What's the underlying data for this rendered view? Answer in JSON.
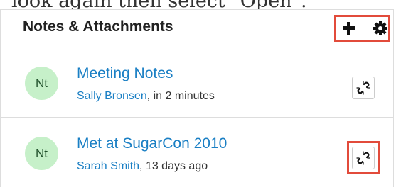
{
  "caption": {
    "text": "look again then select \"Open\"."
  },
  "dashlet": {
    "title": "Notes & Attachments",
    "actions": {
      "add_icon": "plus-icon",
      "settings_icon": "gear-icon"
    },
    "items": [
      {
        "avatar": "Nt",
        "title": "Meeting Notes",
        "author": "Sally Bronsen",
        "time": ", in 2 minutes",
        "action_icon": "unlink-icon"
      },
      {
        "avatar": "Nt",
        "title": "Met at SugarCon 2010",
        "author": "Sarah Smith",
        "time": ", 13 days ago",
        "action_icon": "unlink-icon"
      }
    ]
  },
  "colors": {
    "highlight": "#e24b3b",
    "link": "#1a7fc4",
    "avatar_bg": "#c6f0c9"
  }
}
